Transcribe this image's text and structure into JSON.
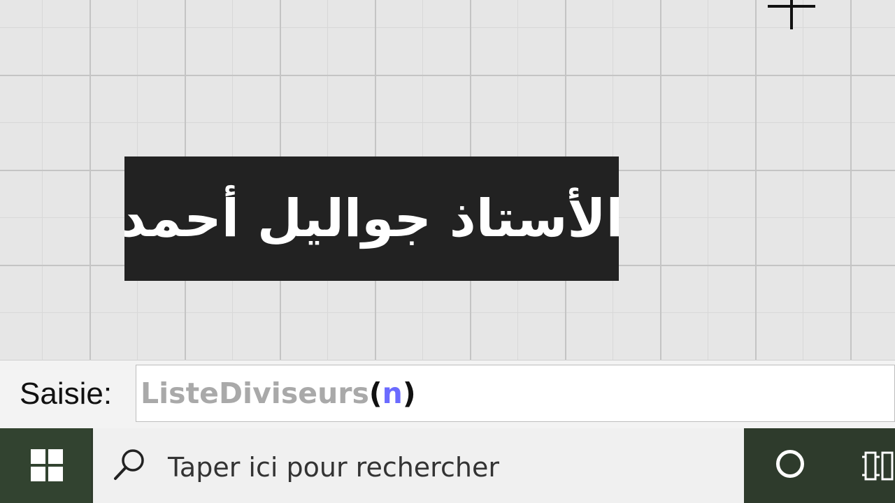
{
  "graphics": {
    "name_label": "الأستاذ جواليل أحمد"
  },
  "input_bar": {
    "label": "Saisie:",
    "command": "ListeDiviseurs",
    "open_paren": "(",
    "argument": "n",
    "close_paren": ")"
  },
  "taskbar": {
    "search_placeholder": "Taper ici pour rechercher",
    "icons": [
      "windows-start-icon",
      "search-icon",
      "cortana-icon",
      "task-view-icon"
    ]
  },
  "colors": {
    "label_background": "#222222",
    "label_text": "#ffffff",
    "command_text": "#a9a9a9",
    "argument_text": "#6b6bff",
    "taskbar": "#2e3b2c"
  }
}
